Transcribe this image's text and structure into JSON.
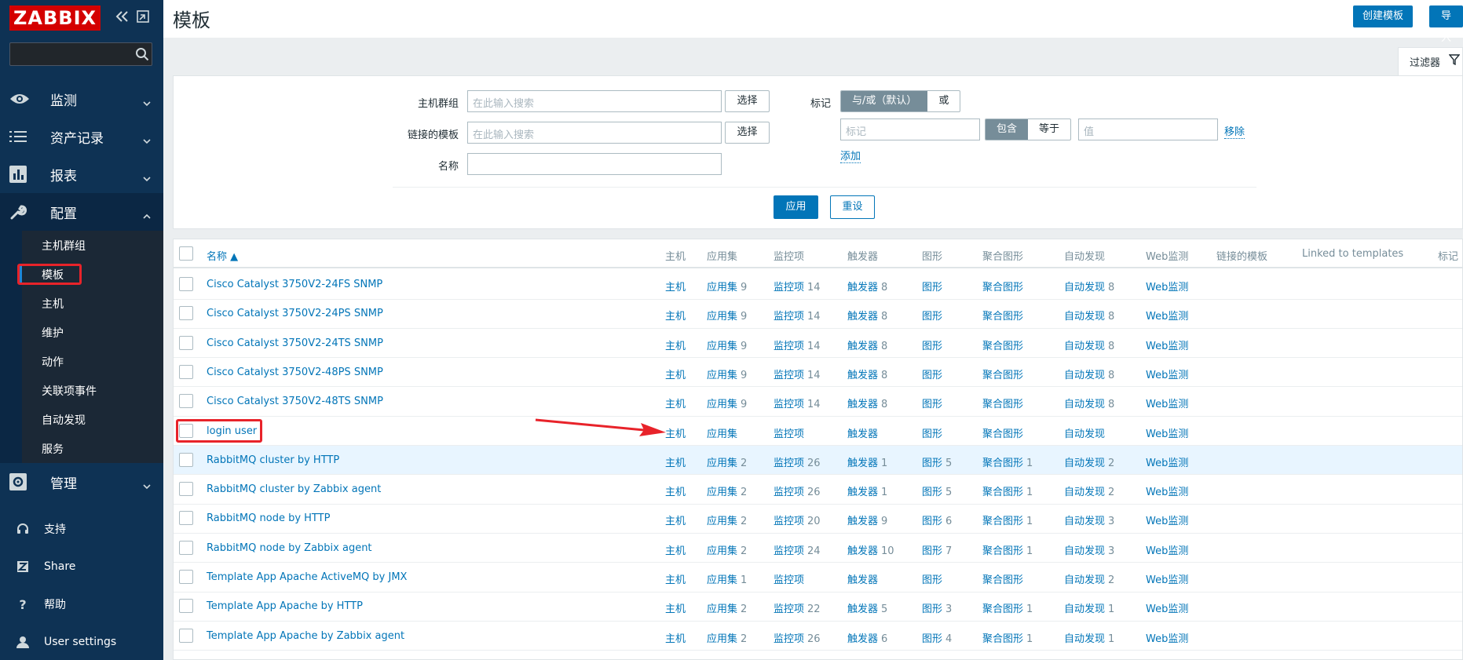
{
  "logo": "ZABBIX",
  "sidebar": {
    "menu": [
      {
        "label": "监测",
        "icon": "eye-icon"
      },
      {
        "label": "资产记录",
        "icon": "list-icon"
      },
      {
        "label": "报表",
        "icon": "chart-icon"
      },
      {
        "label": "配置",
        "icon": "wrench-icon"
      }
    ],
    "config_submenu": [
      "主机群组",
      "模板",
      "主机",
      "维护",
      "动作",
      "关联项事件",
      "自动发现",
      "服务"
    ],
    "admin": {
      "label": "管理",
      "icon": "gear-icon"
    },
    "bottom": [
      {
        "label": "支持",
        "icon": "headset-icon"
      },
      {
        "label": "Share",
        "icon": "share-icon"
      },
      {
        "label": "帮助",
        "icon": "help-icon"
      },
      {
        "label": "User settings",
        "icon": "user-icon"
      }
    ]
  },
  "header": {
    "title": "模板",
    "create_button": "创建模板",
    "import_button": "导入"
  },
  "filter": {
    "tab_label": "过滤器",
    "host_groups_label": "主机群组",
    "host_groups_placeholder": "在此输入搜索",
    "linked_templates_label": "链接的模板",
    "linked_templates_placeholder": "在此输入搜索",
    "name_label": "名称",
    "name_value": "",
    "select_button": "选择",
    "tags_label": "标记",
    "tag_mode_and_or": "与/或（默认）",
    "tag_mode_or": "或",
    "tag_placeholder": "标记",
    "op_contains": "包含",
    "op_equals": "等于",
    "value_placeholder": "值",
    "remove_link": "移除",
    "add_link": "添加",
    "apply_button": "应用",
    "reset_button": "重设"
  },
  "table": {
    "columns": [
      "名称 ▲",
      "主机",
      "应用集",
      "监控项",
      "触发器",
      "图形",
      "聚合图形",
      "自动发现",
      "Web监测",
      "链接的模板",
      "Linked to templates",
      "标记"
    ],
    "rows": [
      {
        "name": "Cisco Catalyst 3750V2-24FS SNMP",
        "host": "主机",
        "apps": "应用集",
        "apps_n": "9",
        "items": "监控项",
        "items_n": "14",
        "triggers": "触发器",
        "triggers_n": "8",
        "graphs": "图形",
        "graphs_n": "",
        "screens": "聚合图形",
        "screens_n": "",
        "discovery": "自动发现",
        "discovery_n": "8",
        "web": "Web监测"
      },
      {
        "name": "Cisco Catalyst 3750V2-24PS SNMP",
        "host": "主机",
        "apps": "应用集",
        "apps_n": "9",
        "items": "监控项",
        "items_n": "14",
        "triggers": "触发器",
        "triggers_n": "8",
        "graphs": "图形",
        "graphs_n": "",
        "screens": "聚合图形",
        "screens_n": "",
        "discovery": "自动发现",
        "discovery_n": "8",
        "web": "Web监测"
      },
      {
        "name": "Cisco Catalyst 3750V2-24TS SNMP",
        "host": "主机",
        "apps": "应用集",
        "apps_n": "9",
        "items": "监控项",
        "items_n": "14",
        "triggers": "触发器",
        "triggers_n": "8",
        "graphs": "图形",
        "graphs_n": "",
        "screens": "聚合图形",
        "screens_n": "",
        "discovery": "自动发现",
        "discovery_n": "8",
        "web": "Web监测"
      },
      {
        "name": "Cisco Catalyst 3750V2-48PS SNMP",
        "host": "主机",
        "apps": "应用集",
        "apps_n": "9",
        "items": "监控项",
        "items_n": "14",
        "triggers": "触发器",
        "triggers_n": "8",
        "graphs": "图形",
        "graphs_n": "",
        "screens": "聚合图形",
        "screens_n": "",
        "discovery": "自动发现",
        "discovery_n": "8",
        "web": "Web监测"
      },
      {
        "name": "Cisco Catalyst 3750V2-48TS SNMP",
        "host": "主机",
        "apps": "应用集",
        "apps_n": "9",
        "items": "监控项",
        "items_n": "14",
        "triggers": "触发器",
        "triggers_n": "8",
        "graphs": "图形",
        "graphs_n": "",
        "screens": "聚合图形",
        "screens_n": "",
        "discovery": "自动发现",
        "discovery_n": "8",
        "web": "Web监测"
      },
      {
        "name": "login user",
        "host": "主机",
        "apps": "应用集",
        "apps_n": "",
        "items": "监控项",
        "items_n": "",
        "triggers": "触发器",
        "triggers_n": "",
        "graphs": "图形",
        "graphs_n": "",
        "screens": "聚合图形",
        "screens_n": "",
        "discovery": "自动发现",
        "discovery_n": "",
        "web": "Web监测"
      },
      {
        "name": "RabbitMQ cluster by HTTP",
        "host": "主机",
        "apps": "应用集",
        "apps_n": "2",
        "items": "监控项",
        "items_n": "26",
        "triggers": "触发器",
        "triggers_n": "1",
        "graphs": "图形",
        "graphs_n": "5",
        "screens": "聚合图形",
        "screens_n": "1",
        "discovery": "自动发现",
        "discovery_n": "2",
        "web": "Web监测"
      },
      {
        "name": "RabbitMQ cluster by Zabbix agent",
        "host": "主机",
        "apps": "应用集",
        "apps_n": "2",
        "items": "监控项",
        "items_n": "26",
        "triggers": "触发器",
        "triggers_n": "1",
        "graphs": "图形",
        "graphs_n": "5",
        "screens": "聚合图形",
        "screens_n": "1",
        "discovery": "自动发现",
        "discovery_n": "2",
        "web": "Web监测"
      },
      {
        "name": "RabbitMQ node by HTTP",
        "host": "主机",
        "apps": "应用集",
        "apps_n": "2",
        "items": "监控项",
        "items_n": "20",
        "triggers": "触发器",
        "triggers_n": "9",
        "graphs": "图形",
        "graphs_n": "6",
        "screens": "聚合图形",
        "screens_n": "1",
        "discovery": "自动发现",
        "discovery_n": "3",
        "web": "Web监测"
      },
      {
        "name": "RabbitMQ node by Zabbix agent",
        "host": "主机",
        "apps": "应用集",
        "apps_n": "2",
        "items": "监控项",
        "items_n": "24",
        "triggers": "触发器",
        "triggers_n": "10",
        "graphs": "图形",
        "graphs_n": "7",
        "screens": "聚合图形",
        "screens_n": "1",
        "discovery": "自动发现",
        "discovery_n": "3",
        "web": "Web监测"
      },
      {
        "name": "Template App Apache ActiveMQ by JMX",
        "host": "主机",
        "apps": "应用集",
        "apps_n": "1",
        "items": "监控项",
        "items_n": "",
        "triggers": "触发器",
        "triggers_n": "",
        "graphs": "图形",
        "graphs_n": "",
        "screens": "聚合图形",
        "screens_n": "",
        "discovery": "自动发现",
        "discovery_n": "2",
        "web": "Web监测"
      },
      {
        "name": "Template App Apache by HTTP",
        "host": "主机",
        "apps": "应用集",
        "apps_n": "2",
        "items": "监控项",
        "items_n": "22",
        "triggers": "触发器",
        "triggers_n": "5",
        "graphs": "图形",
        "graphs_n": "3",
        "screens": "聚合图形",
        "screens_n": "1",
        "discovery": "自动发现",
        "discovery_n": "1",
        "web": "Web监测"
      },
      {
        "name": "Template App Apache by Zabbix agent",
        "host": "主机",
        "apps": "应用集",
        "apps_n": "2",
        "items": "监控项",
        "items_n": "26",
        "triggers": "触发器",
        "triggers_n": "6",
        "graphs": "图形",
        "graphs_n": "4",
        "screens": "聚合图形",
        "screens_n": "1",
        "discovery": "自动发现",
        "discovery_n": "1",
        "web": "Web监测"
      }
    ]
  },
  "colors": {
    "accent": "#0275b8",
    "sidebar": "#0e3254",
    "highlight": "#e8232a"
  }
}
